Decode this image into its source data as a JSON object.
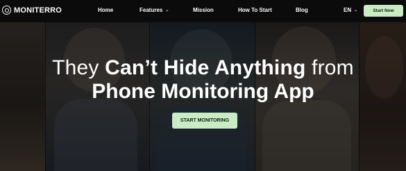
{
  "brand": {
    "name": "MONITERRO"
  },
  "nav": {
    "home": "Home",
    "features": "Features",
    "mission": "Mission",
    "how_to_start": "How To Start",
    "blog": "Blog",
    "language": "EN"
  },
  "header_cta": "Start Now",
  "hero": {
    "headline_part1": "They ",
    "headline_part2": "Can’t Hide Anything",
    "headline_part3": " from",
    "headline_line2": "Phone Monitoring App",
    "cta": "START MONITORING"
  },
  "icons": {
    "chevron": "chevron-down-icon",
    "logo": "moniterro-logo-icon"
  },
  "colors": {
    "accent": "#c9ecc5",
    "header_bg": "#0b0b0b"
  }
}
